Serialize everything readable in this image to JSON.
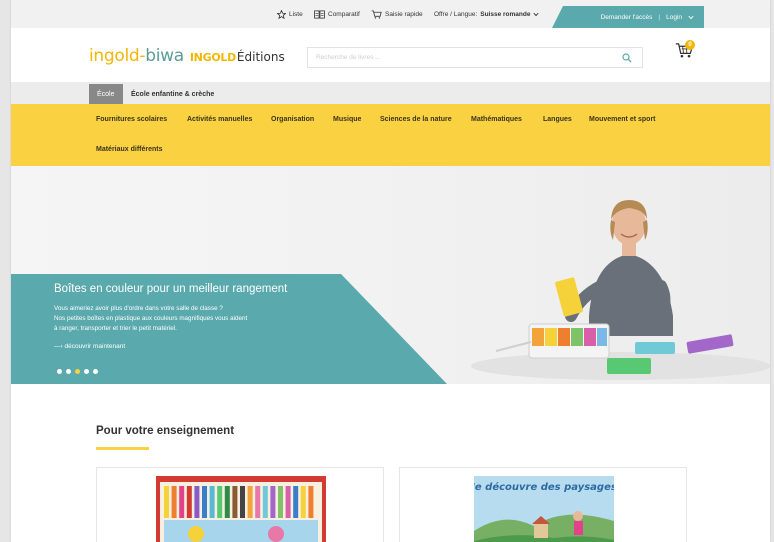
{
  "topbar": {
    "list_label": "Liste",
    "compare_label": "Comparatif",
    "quick_label": "Saisie rapide",
    "offer_prefix": "Offre / Langue:",
    "offer_value": "Suisse romande",
    "access_label": "Demander l'accès",
    "separator": "|",
    "login_label": "Login"
  },
  "header": {
    "logo_part1": "ingold",
    "logo_dash": "-",
    "logo_part2": "biwa",
    "logo_ingold": "INGOLD",
    "logo_editions": "Éditions",
    "search_placeholder": "Recherche de livres ...",
    "cart_count": "0"
  },
  "tabs": [
    "École",
    "École enfantine & crèche"
  ],
  "nav": [
    "Fournitures scolaires",
    "Activités manuelles",
    "Organisation",
    "Musique",
    "Sciences de la nature",
    "Mathématiques",
    "Langues",
    "Mouvement et sport",
    "Matériaux différents"
  ],
  "hero": {
    "title": "Boîtes en couleur pour un meilleur rangement",
    "line1": "Vous aimeriez avoir plus d'ordre dans votre salle de classe ?",
    "line2": "Nos petites boîtes en plastique aux couleurs magnifiques vous aident",
    "line3": "à ranger, transporter et trier le petit matériel.",
    "cta": "—› découvrir maintenant",
    "active_slide": 3,
    "slide_count": 5
  },
  "section": {
    "title": "Pour votre enseignement",
    "card2_title": "Je découvre des paysages"
  },
  "colors": {
    "accent_yellow": "#f9d141",
    "teal": "#5aa9ad",
    "logo_yellow": "#f2b705"
  }
}
